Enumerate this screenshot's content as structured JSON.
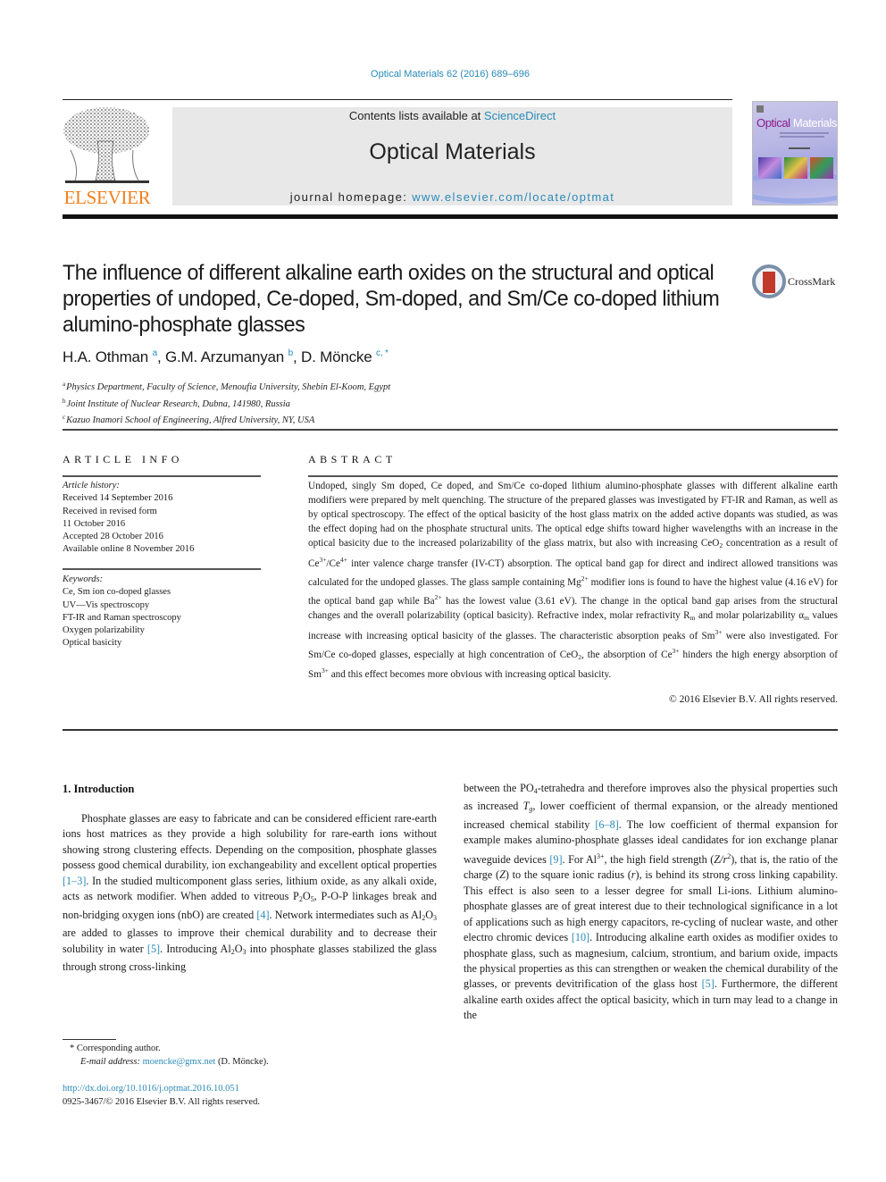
{
  "journal_ref": "Optical Materials 62 (2016) 689–696",
  "header": {
    "publisher_logo_text": "ELSEVIER",
    "contents_prefix": "Contents lists available at ",
    "contents_link": "ScienceDirect",
    "journal_title": "Optical Materials",
    "homepage_prefix": "journal homepage: ",
    "homepage_link": "www.elsevier.com/locate/optmat",
    "cover_title_part1": "Optical",
    "cover_title_part2": "Materials"
  },
  "crossmark": {
    "label": "CrossMark",
    "icon": "crossmark-icon"
  },
  "article": {
    "title": "The influence of different alkaline earth oxides on the structural and optical properties of undoped, Ce-doped, Sm-doped, and Sm/Ce co-doped lithium alumino-phosphate glasses",
    "authors": [
      {
        "name": "H.A. Othman",
        "sup": "a"
      },
      {
        "name": "G.M. Arzumanyan",
        "sup": "b"
      },
      {
        "name": "D. Möncke",
        "sup": "c, *"
      }
    ],
    "author_separator": ", ",
    "affiliations": [
      {
        "key": "a",
        "text": "Physics Department, Faculty of Science, Menoufia University, Shebin El-Koom, Egypt"
      },
      {
        "key": "b",
        "text": "Joint Institute of Nuclear Research, Dubna, 141980, Russia"
      },
      {
        "key": "c",
        "text": "Kazuo Inamori School of Engineering, Alfred University, NY, USA"
      }
    ]
  },
  "article_info": {
    "heading": "ARTICLE INFO",
    "history_label": "Article history:",
    "history": [
      "Received 14 September 2016",
      "Received in revised form",
      "11 October 2016",
      "Accepted 28 October 2016",
      "Available online 8 November 2016"
    ],
    "keywords_label": "Keywords:",
    "keywords": [
      "Ce, Sm ion co-doped glasses",
      "UV—Vis spectroscopy",
      "FT-IR and Raman spectroscopy",
      "Oxygen polarizability",
      "Optical basicity"
    ]
  },
  "abstract": {
    "heading": "ABSTRACT",
    "p1": "Undoped, singly Sm doped, Ce doped, and Sm/Ce co-doped lithium alumino-phosphate glasses with different alkaline earth modifiers were prepared by melt quenching. The structure of the prepared glasses was investigated by FT-IR and Raman, as well as by optical spectroscopy. The effect of the optical basicity of the host glass matrix on the added active dopants was studied, as was the effect doping had on the phosphate structural units. The optical edge shifts toward higher wavelengths with an increase in the optical basicity due to the increased polarizability of the glass matrix, but also with increasing CeO",
    "s1": "2",
    "p2": " concentration as a result of Ce",
    "s2": "3+",
    "p3": "/Ce",
    "s3": "4+",
    "p4": " inter valence charge transfer (IV-CT) absorption. The optical band gap for direct and indirect allowed transitions was calculated for the undoped glasses. The glass sample containing Mg",
    "s4": "2+",
    "p5": " modifier ions is found to have the highest value (4.16 eV) for the optical band gap while Ba",
    "s5": "2+",
    "p6": " has the lowest value (3.61 eV). The change in the optical band gap arises from the structural changes and the overall polarizability (optical basicity). Refractive index, molar refractivity R",
    "s6": "m",
    "p7": " and molar polarizability α",
    "s7": "m",
    "p8": " values increase with increasing optical basicity of the glasses. The characteristic absorption peaks of Sm",
    "s8": "3+",
    "p9": " were also investigated. For Sm/Ce co-doped glasses, especially at high concentration of CeO",
    "s9": "2",
    "p10": ", the absorption of Ce",
    "s10": "3+",
    "p11": " hinders the high energy absorption of Sm",
    "s11": "3+",
    "p12": " and this effect becomes more obvious with increasing optical basicity.",
    "copyright": "© 2016 Elsevier B.V. All rights reserved."
  },
  "introduction": {
    "heading": "1.  Introduction",
    "left": {
      "t1": "Phosphate glasses are easy to fabricate and can be considered efficient rare-earth ions host matrices as they provide a high solubility for rare-earth ions without showing strong clustering effects. Depending on the composition, phosphate glasses possess good chemical durability, ion exchangeability and excellent optical properties ",
      "r1": "[1–3]",
      "t2": ". In the studied multicomponent glass series, lithium oxide, as any alkali oxide, acts as network modifier. When added to vitreous P",
      "s1": "2",
      "t3": "O",
      "s2": "5",
      "t4": ", P-O-P linkages break and non-bridging oxygen ions (nbO) are created ",
      "r2": "[4]",
      "t5": ". Network intermediates such as Al",
      "s3": "2",
      "t6": "O",
      "s4": "3",
      "t7": " are added to glasses to improve their chemical durability and to decrease their solubility in water ",
      "r3": "[5]",
      "t8": ". Introducing Al",
      "s5": "2",
      "t9": "O",
      "s6": "3",
      "t10": " into phosphate glasses stabilized the glass through strong cross-linking"
    },
    "right": {
      "t1": "between the PO",
      "s1": "4",
      "t2": "-tetrahedra and therefore improves also the physical properties such as increased ",
      "tg": "T",
      "tg_sub": "g",
      "t3": ", lower coefficient of thermal expansion, or the already mentioned increased chemical stability ",
      "r1": "[6–8]",
      "t4": ". The low coefficient of thermal expansion for example makes alumino-phosphate glasses ideal candidates for ion exchange planar waveguide devices ",
      "r2": "[9]",
      "t5": ". For Al",
      "sup1": "3+",
      "t6": ", the high field strength (",
      "z1": "Z/r",
      "sup2": "2",
      "t7": "), that is, the ratio of the charge (",
      "z2": "Z",
      "t8": ") to the square ionic radius (",
      "r_var": "r",
      "t9": "), is behind its strong cross linking capability. This effect is also seen to a lesser degree for small Li-ions. Lithium alumino-phosphate glasses are of great interest due to their technological significance in a lot of applications such as high energy capacitors, re-cycling of nuclear waste, and other electro chromic devices ",
      "r3": "[10]",
      "t10": ". Introducing alkaline earth oxides as modifier oxides to phosphate glass, such as magnesium, calcium, strontium, and barium oxide, impacts the physical properties as this can strengthen or weaken the chemical durability of the glasses, or prevents devitrification of the glass host ",
      "r4": "[5]",
      "t11": ". Furthermore, the different alkaline earth oxides affect the optical basicity, which in turn may lead to a change in the"
    }
  },
  "footnotes": {
    "corresponding_marker": "*",
    "corresponding_text": " Corresponding author.",
    "email_label": "E-mail address: ",
    "email": "moencke@gmx.net",
    "email_suffix": " (D. Möncke).",
    "doi": "http://dx.doi.org/10.1016/j.optmat.2016.10.051",
    "issn_copyright": "0925-3467/© 2016 Elsevier B.V. All rights reserved."
  },
  "colors": {
    "link": "#2a8ab8",
    "elsevier_orange": "#f07f1e",
    "header_band": "#e8e8e8",
    "cover_magenta": "#8c1a8c",
    "crossmark_red": "#c0392b"
  }
}
